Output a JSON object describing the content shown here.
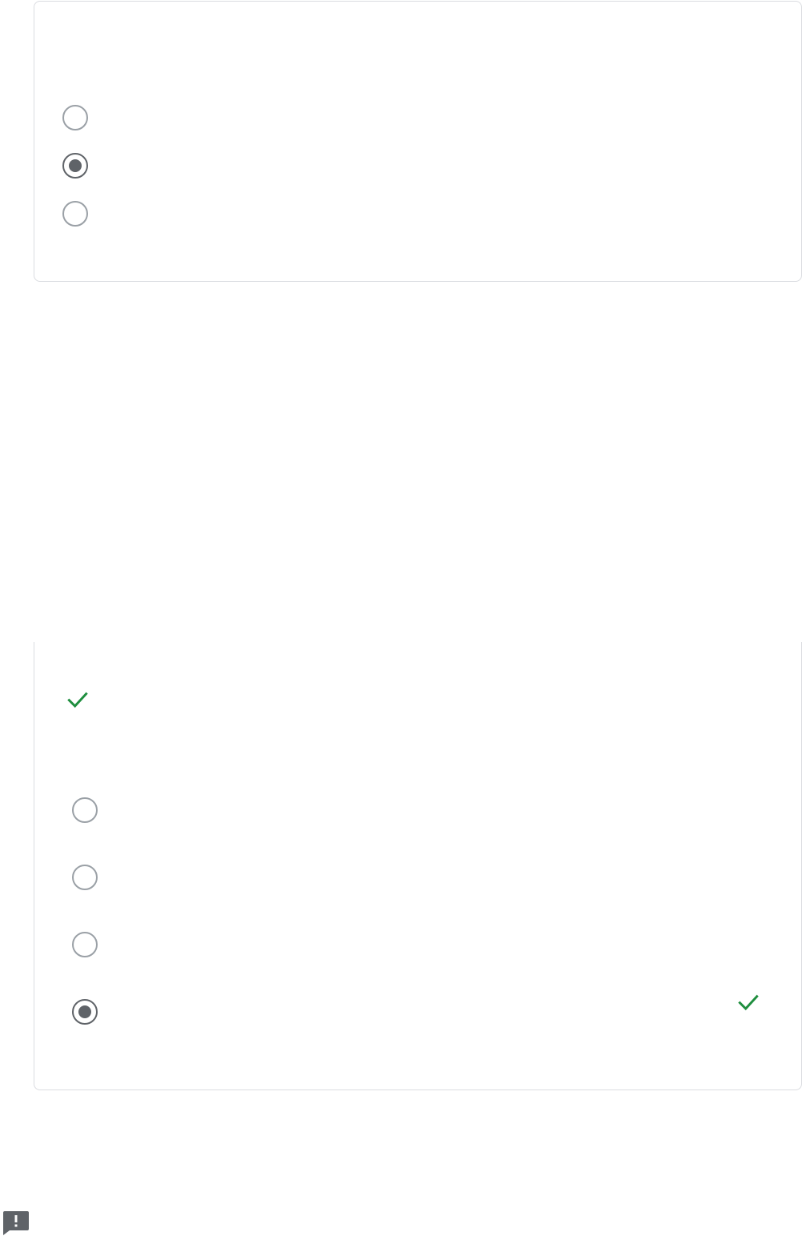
{
  "question_1": {
    "options": [
      {
        "label": "",
        "checked": false
      },
      {
        "label": "",
        "checked": true
      },
      {
        "label": "",
        "checked": false
      }
    ]
  },
  "question_2": {
    "status_icon": "check-icon",
    "options": [
      {
        "label": "",
        "checked": false
      },
      {
        "label": "",
        "checked": false
      },
      {
        "label": "",
        "checked": false
      },
      {
        "label": "",
        "checked": true,
        "correct": true
      }
    ]
  },
  "colors": {
    "correct": "#1e8e3e",
    "radio_unchecked": "#9aa0a6",
    "radio_checked": "#5f6368",
    "card_border": "#dadce0",
    "feedback_icon": "#5f6368"
  }
}
